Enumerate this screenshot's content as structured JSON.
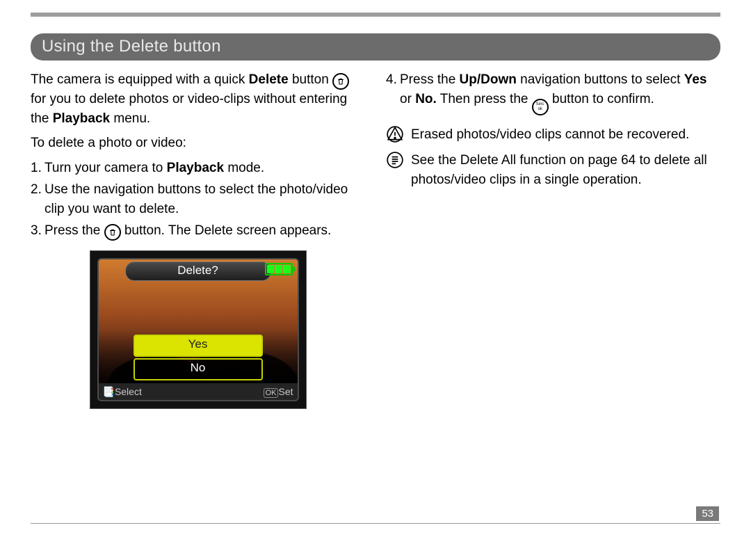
{
  "page_number": "53",
  "section_title": "Using the Delete button",
  "left": {
    "intro_parts": {
      "a": "The camera is equipped with a quick ",
      "b_bold": "Delete",
      "c": " button ",
      "d": " for you to delete photos or video-clips without entering the ",
      "e_bold": "Playback",
      "f": " menu."
    },
    "subhead": "To delete a photo or video:",
    "steps": {
      "1": {
        "a": "Turn your camera to ",
        "b_bold": "Playback",
        "c": " mode."
      },
      "2": {
        "a": "Use the navigation buttons to select the photo/video clip you want to delete."
      },
      "3": {
        "a": "Press the ",
        "b": " button. The Delete screen appears."
      }
    }
  },
  "right": {
    "step4": {
      "a": "Press the ",
      "b_bold": "Up/Down",
      "c": " navigation buttons to select ",
      "d_bold": "Yes",
      "e": " or ",
      "f_bold": "No.",
      "g": " Then press the ",
      "h": " button to confirm."
    },
    "note_warning": "Erased photos/video clips cannot be recovered.",
    "note_info": "See the Delete All function on page 64 to delete all photos/video clips in a single operation."
  },
  "lcd": {
    "title": "Delete?",
    "yes": "Yes",
    "no": "No",
    "bottom_left": "Select",
    "bottom_right_prefix": "OK",
    "bottom_right": "Set"
  },
  "icon_labels": {
    "func_top": "func",
    "func_bottom": "ok"
  }
}
